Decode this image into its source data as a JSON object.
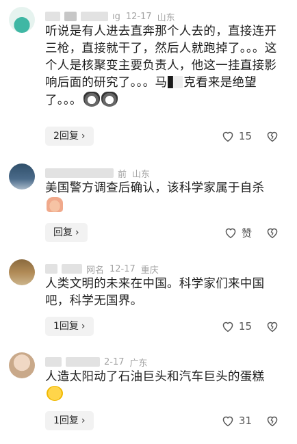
{
  "comments": [
    {
      "meta_tail": "ıg",
      "date": "12-17",
      "location": "山东",
      "text_a": "听说是有人进去直奔那个人去的，直接连开三枪，直接就干了，然后人就跑掉了。。。这个人是核聚变主要负责人，他这一挂直接影响后面的研究了。。。马",
      "text_b": "克看来是绝望了。。。",
      "reply_label": "2回复",
      "like_count": "15"
    },
    {
      "meta_tail": "前",
      "location": "山东",
      "text": "美国警方调查后确认，该科学家属于自杀",
      "reply_label": "回复",
      "like_count": "赞"
    },
    {
      "meta_tail": "网名",
      "date": "12-17",
      "location": "重庆",
      "text": "人类文明的未来在中国。科学家们来中国吧，科学无国界。",
      "reply_label": "1回复",
      "like_count": "15"
    },
    {
      "meta_tail": "2-17",
      "location": "广东",
      "text": "人造太阳动了石油巨头和汽车巨头的蛋糕",
      "reply_label": "1回复",
      "like_count": "31"
    }
  ],
  "icons": {
    "like": "heart-outline-icon",
    "dislike": "broken-heart-icon",
    "chevron": "chevron-right-icon"
  },
  "colors": {
    "meta_gray": "#a3a3a3",
    "reply_bg": "#f2f2f2",
    "text": "#1e1e1e"
  }
}
